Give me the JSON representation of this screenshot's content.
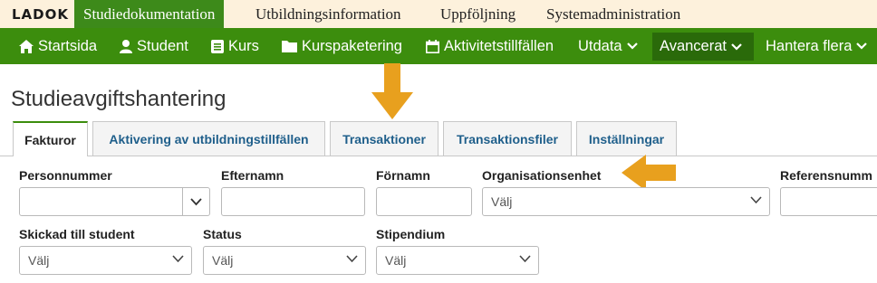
{
  "app": {
    "logo": "LADOK"
  },
  "topnav": [
    {
      "label": "Studiedokumentation",
      "active": true
    },
    {
      "label": "Utbildningsinformation",
      "active": false
    },
    {
      "label": "Uppföljning",
      "active": false
    },
    {
      "label": "Systemadministration",
      "active": false
    }
  ],
  "mainnav": [
    {
      "label": "Startsida",
      "icon": "home-icon"
    },
    {
      "label": "Student",
      "icon": "user-icon"
    },
    {
      "label": "Kurs",
      "icon": "book-icon"
    },
    {
      "label": "Kurspaketering",
      "icon": "folder-icon"
    },
    {
      "label": "Aktivitetstillfällen",
      "icon": "calendar-icon"
    },
    {
      "label": "Utdata",
      "icon": "chevron-down-icon"
    },
    {
      "label": "Avancerat",
      "icon": "chevron-down-icon",
      "active": true
    },
    {
      "label": "Hantera flera",
      "icon": "chevron-down-icon"
    }
  ],
  "page": {
    "title": "Studieavgiftshantering"
  },
  "tabs": [
    {
      "label": "Fakturor",
      "active": true
    },
    {
      "label": "Aktivering av utbildningstillfällen"
    },
    {
      "label": "Transaktioner"
    },
    {
      "label": "Transaktionsfiler"
    },
    {
      "label": "Inställningar"
    }
  ],
  "filters": {
    "personnummer": {
      "label": "Personnummer",
      "value": ""
    },
    "efternamn": {
      "label": "Efternamn",
      "value": ""
    },
    "fornamn": {
      "label": "Förnamn",
      "value": ""
    },
    "organisationsenhet": {
      "label": "Organisationsenhet",
      "value": "Välj"
    },
    "referensnummer": {
      "label": "Referensnumm",
      "value": ""
    },
    "skickad": {
      "label": "Skickad till student",
      "value": "Välj"
    },
    "status": {
      "label": "Status",
      "value": "Välj"
    },
    "stipendium": {
      "label": "Stipendium",
      "value": "Välj"
    }
  },
  "colors": {
    "green": "#3c8d0d",
    "dark_green": "#2a6a0a",
    "topbar": "#fdf1dc",
    "arrow": "#e8a01e",
    "link": "#1f5f8b"
  }
}
